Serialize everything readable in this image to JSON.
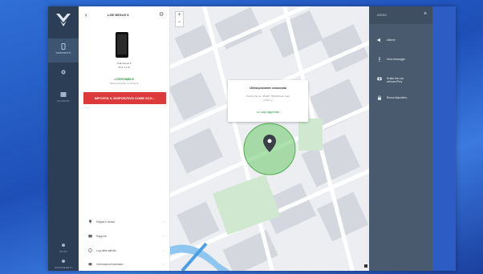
{
  "sidebar": {
    "items": [
      {
        "label": "DISPOSITIVI"
      },
      {
        "label": ""
      },
      {
        "label": "ACCOUNT"
      },
      {
        "label": "AIUTO"
      },
      {
        "label": "DISCONNETTI"
      }
    ]
  },
  "device": {
    "header_title": "LGE NEXUS 5",
    "name": "LGE Nexus 5",
    "sub": "Prot. 1.2.8",
    "status": "● DISPONIBILE",
    "status_line": "Ultimo accesso: 2 minuti fa",
    "danger_button": "IMPOSTA IL DISPOSITIVO COME SCO..."
  },
  "menu": [
    {
      "label": "Mappa e azioni"
    },
    {
      "label": "Rapporti"
    },
    {
      "label": "Log delle attività"
    },
    {
      "label": "Informazioni hardware"
    }
  ],
  "map": {
    "zoom_in": "+",
    "zoom_out": "−",
    "popup_title": "Ultima posizione conosciuta",
    "popup_address": "Piazza Fiume, 00198, TRIONFALE, Italy",
    "popup_accuracy": "(± 50 m)",
    "popup_link": "⊕ Luogo aggiornato"
  },
  "actions": {
    "title": "AZIONI",
    "close": "×",
    "items": [
      {
        "label": "Allarme",
        "label2": ""
      },
      {
        "label": "Invia messaggio",
        "label2": ""
      },
      {
        "label": "Scatta foto con",
        "label2": "webcam/Prey"
      },
      {
        "label": "Blocca dispositivo",
        "label2": ""
      }
    ]
  },
  "colors": {
    "accent_green": "#2e9a3e",
    "danger_red": "#dd3b3b",
    "rail_bg": "#2c3e55",
    "actions_bg": "#4a5a6e"
  }
}
